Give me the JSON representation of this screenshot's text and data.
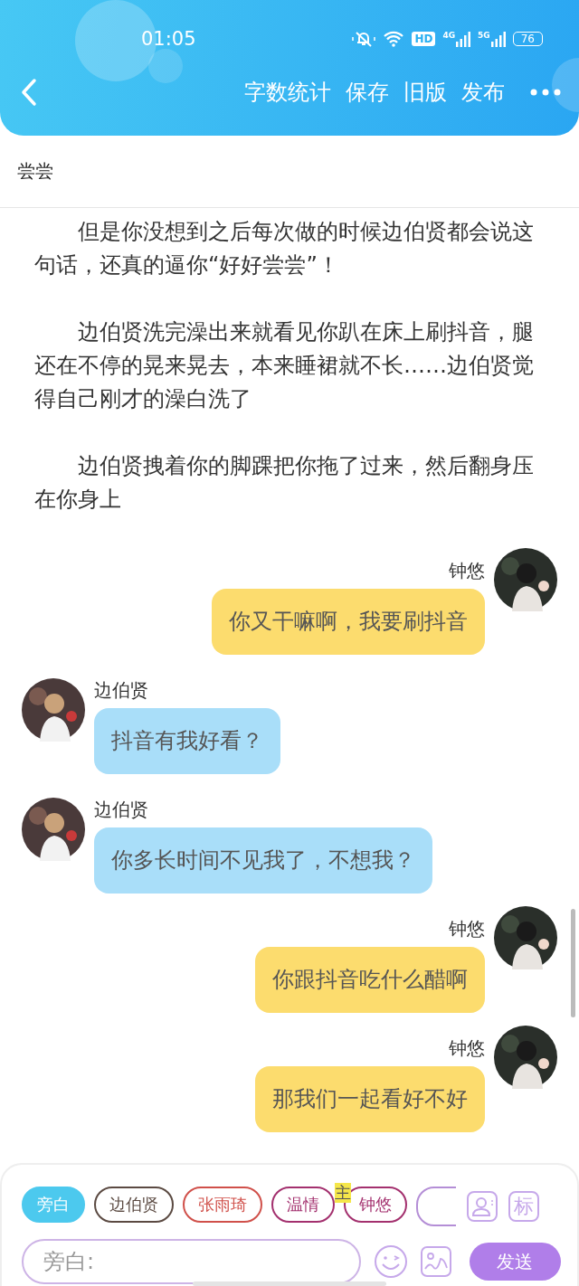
{
  "status_bar": {
    "time": "01:05",
    "hd_label": "HD",
    "network_labels": [
      "4G",
      "5G"
    ],
    "battery": "76"
  },
  "toolbar": {
    "actions": [
      "字数统计",
      "保存",
      "旧版",
      "发布"
    ]
  },
  "document": {
    "title": "尝尝"
  },
  "story": [
    "但是你没想到之后每次做的时候边伯贤都会说这句话，还真的逼你“好好尝尝”！",
    "边伯贤洗完澡出来就看见你趴在床上刷抖音，腿还在不停的晃来晃去，本来睡裙就不长……边伯贤觉得自己刚才的澡白洗了",
    "边伯贤拽着你的脚踝把你拖了过来，然后翻身压在你身上"
  ],
  "messages": [
    {
      "kind": "outgoing",
      "name": "钟悠",
      "text": "你又干嘛啊，我要刷抖音"
    },
    {
      "kind": "incoming",
      "name": "边伯贤",
      "text": "抖音有我好看？"
    },
    {
      "kind": "incoming",
      "name": "边伯贤",
      "text": "你多长时间不见我了，不想我？"
    },
    {
      "kind": "outgoing",
      "name": "钟悠",
      "text": "你跟抖音吃什么醋啊"
    },
    {
      "kind": "outgoing",
      "name": "钟悠",
      "text": "那我们一起看好不好"
    }
  ],
  "composer": {
    "roles": [
      {
        "label": "旁白",
        "selected": true,
        "color": "#4cc9ee",
        "main": false
      },
      {
        "label": "边伯贤",
        "selected": false,
        "color": "#5b4a42",
        "main": false
      },
      {
        "label": "张雨琦",
        "selected": false,
        "color": "#d0504a",
        "main": false
      },
      {
        "label": "温情",
        "selected": false,
        "color": "#a3306e",
        "main": false
      },
      {
        "label": "钟悠",
        "selected": false,
        "color": "#a3306e",
        "main": true
      }
    ],
    "main_badge": "主",
    "mark_button": "标",
    "placeholder": "旁白:",
    "send": "发送"
  }
}
